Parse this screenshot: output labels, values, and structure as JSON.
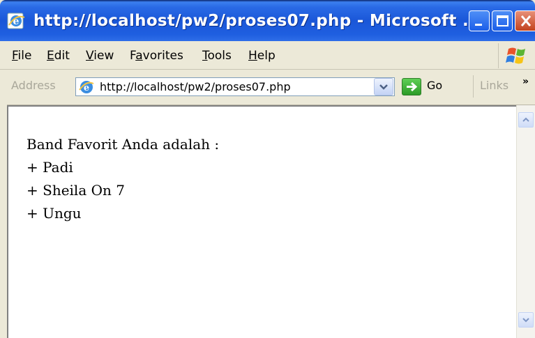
{
  "window": {
    "title": "http://localhost/pw2/proses07.php - Microsoft ...",
    "buttons": {
      "minimize": "minimize",
      "maximize": "maximize",
      "close": "close"
    }
  },
  "menubar": {
    "items": [
      {
        "label": "File",
        "accel": "F",
        "rest": "ile"
      },
      {
        "label": "Edit",
        "accel": "E",
        "rest": "dit"
      },
      {
        "label": "View",
        "accel": "V",
        "rest": "iew"
      },
      {
        "label": "Favorites",
        "pre": "F",
        "accel": "a",
        "rest": "vorites"
      },
      {
        "label": "Tools",
        "accel": "T",
        "rest": "ools"
      },
      {
        "label": "Help",
        "accel": "H",
        "rest": "elp"
      }
    ]
  },
  "addressbar": {
    "label": "Address",
    "url": "http://localhost/pw2/proses07.php",
    "go_label": "Go",
    "links_label": "Links",
    "links_more": "»"
  },
  "page": {
    "heading": "Band Favorit Anda adalah :",
    "items": [
      "+ Padi",
      "+ Sheila On 7",
      "+ Ungu"
    ]
  },
  "colors": {
    "titlebar": "#2a6ae6",
    "chrome": "#ece9d8",
    "close_button": "#c2421e",
    "go_button": "#2c9b27"
  }
}
